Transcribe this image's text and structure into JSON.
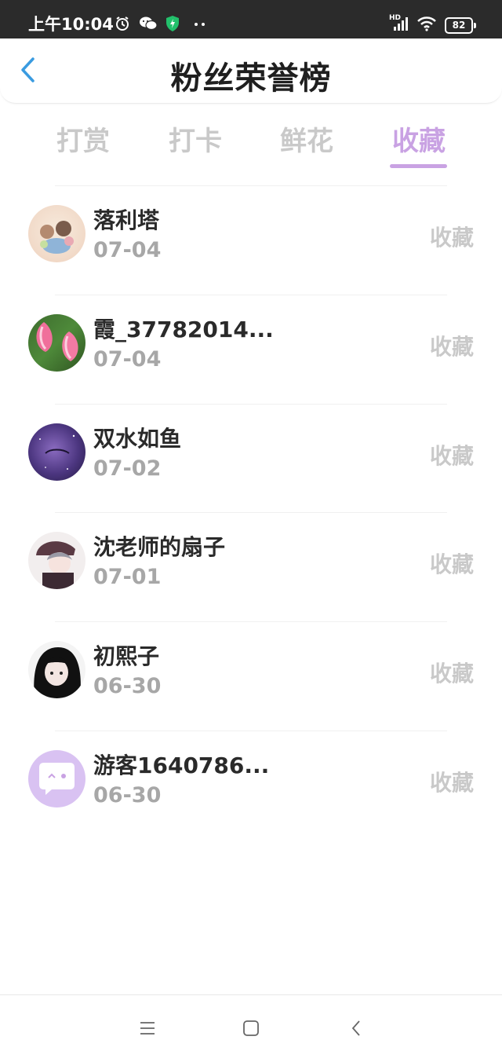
{
  "status_bar": {
    "time": "上午10:04",
    "battery": "82",
    "network": "HD"
  },
  "header": {
    "title": "粉丝荣誉榜"
  },
  "tabs": [
    {
      "label": "打赏"
    },
    {
      "label": "打卡"
    },
    {
      "label": "鲜花"
    },
    {
      "label": "收藏"
    }
  ],
  "active_tab": "收藏",
  "fans": [
    {
      "name": "落利塔",
      "date": "07-04",
      "action": "收藏"
    },
    {
      "name": "霞_37782014...",
      "date": "07-04",
      "action": "收藏"
    },
    {
      "name": "双水如鱼",
      "date": "07-02",
      "action": "收藏"
    },
    {
      "name": "沈老师的扇子",
      "date": "07-01",
      "action": "收藏"
    },
    {
      "name": "初熙子",
      "date": "06-30",
      "action": "收藏"
    },
    {
      "name": "游客1640786...",
      "date": "06-30",
      "action": "收藏"
    }
  ],
  "colors": {
    "accent": "#c9a2e3",
    "back_arrow": "#3a9be0",
    "inactive_text": "#c9c9c9",
    "date_text": "#a7a7a7"
  }
}
